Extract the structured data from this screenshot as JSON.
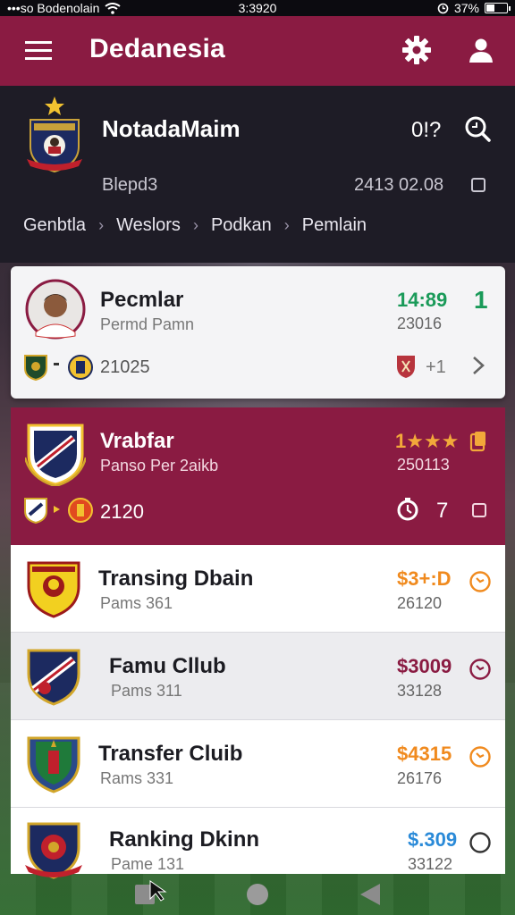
{
  "status_bar": {
    "carrier": "•••so Bodenolain",
    "time": "3:3920",
    "battery": "37%"
  },
  "app_bar": {
    "title": "Dedanesia",
    "menu_icon": "hamburger-icon",
    "settings_icon": "gear-icon",
    "profile_icon": "user-icon"
  },
  "header": {
    "name": "NotadaMaim",
    "score": "0!?",
    "subtitle": "Blepd3",
    "date": "2413 02.08",
    "breadcrumb": [
      "Genbtla",
      "Weslors",
      "Podkan",
      "Pemlain"
    ]
  },
  "cards": [
    {
      "name": "Pecmlar",
      "sub": "Permd Pamn",
      "value": "14:89",
      "value2": "23016",
      "footer": "21025",
      "footer_right": "+1",
      "value_color": "#1a9a59",
      "badge_text": "1"
    },
    {
      "name": "Vrabfar",
      "sub": "Panso Per 2aikb",
      "value": "1★★★",
      "value2": "250113",
      "footer": "2120",
      "footer_right": "7",
      "value_color": "#f2a83a"
    }
  ],
  "rows": [
    {
      "name": "Transing Dbain",
      "sub": "Pams 361",
      "value": "$3+:D",
      "value2": "26120",
      "value_color": "#f08a1e",
      "icon_color": "#f08a1e"
    },
    {
      "name": "Famu Cllub",
      "sub": "Pams 311",
      "value": "$3009",
      "value2": "33128",
      "value_color": "#8a1b42",
      "icon_color": "#8a1b42"
    },
    {
      "name": "Transfer Cluib",
      "sub": "Rams 331",
      "value": "$4315",
      "value2": "26176",
      "value_color": "#f08a1e",
      "icon_color": "#f08a1e"
    },
    {
      "name": "Ranking Dkinn",
      "sub": "Pame 131",
      "value": "$.309",
      "value2": "33122",
      "value_color": "#2a8ad8",
      "icon_color": "#333333"
    }
  ],
  "colors": {
    "brand": "#8a1b42",
    "dark": "#1e1c26"
  }
}
